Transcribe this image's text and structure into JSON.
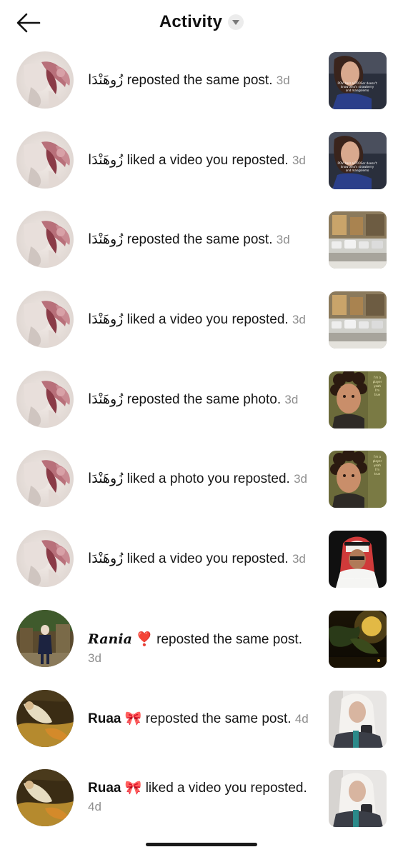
{
  "header": {
    "title": "Activity",
    "back_icon": "arrow-left-icon",
    "dropdown_icon": "caret-down-icon"
  },
  "notifications": [
    {
      "user": "زُوهَنْدَا",
      "action": "reposted the same post.",
      "time": "3d",
      "avatar": "flowers",
      "thumb": "girl-caption"
    },
    {
      "user": "زُوهَنْدَا",
      "action": "liked a video you reposted.",
      "time": "3d",
      "avatar": "flowers",
      "thumb": "girl-caption"
    },
    {
      "user": "زُوهَنْدَا",
      "action": "reposted the same post.",
      "time": "3d",
      "avatar": "flowers",
      "thumb": "cars"
    },
    {
      "user": "زُوهَنْدَا",
      "action": "liked a video you reposted.",
      "time": "3d",
      "avatar": "flowers",
      "thumb": "cars"
    },
    {
      "user": "زُوهَنْدَا",
      "action": "reposted the same photo.",
      "time": "3d",
      "avatar": "flowers",
      "thumb": "curly-boy"
    },
    {
      "user": "زُوهَنْدَا",
      "action": "liked a photo you reposted.",
      "time": "3d",
      "avatar": "flowers",
      "thumb": "curly-boy"
    },
    {
      "user": "زُوهَنْدَا",
      "action": "liked a video you reposted.",
      "time": "3d",
      "avatar": "flowers",
      "thumb": "man-shemagh"
    },
    {
      "user": "Rania",
      "user_suffix": "❣️",
      "action": "reposted the same post.",
      "time": "3d",
      "avatar": "rania",
      "thumb": "night-tree"
    },
    {
      "user": "Ruaa",
      "user_suffix": "🎀",
      "action": "reposted the same post.",
      "time": "4d",
      "avatar": "painting",
      "thumb": "hijab-girl"
    },
    {
      "user": "Ruaa",
      "user_suffix": "🎀",
      "action": "liked a video you reposted.",
      "time": "4d",
      "avatar": "painting",
      "thumb": "hijab-girl"
    }
  ],
  "colors": {
    "time_text": "#8e8e8e",
    "primary_text": "#161616",
    "heart": "#e0242c"
  }
}
